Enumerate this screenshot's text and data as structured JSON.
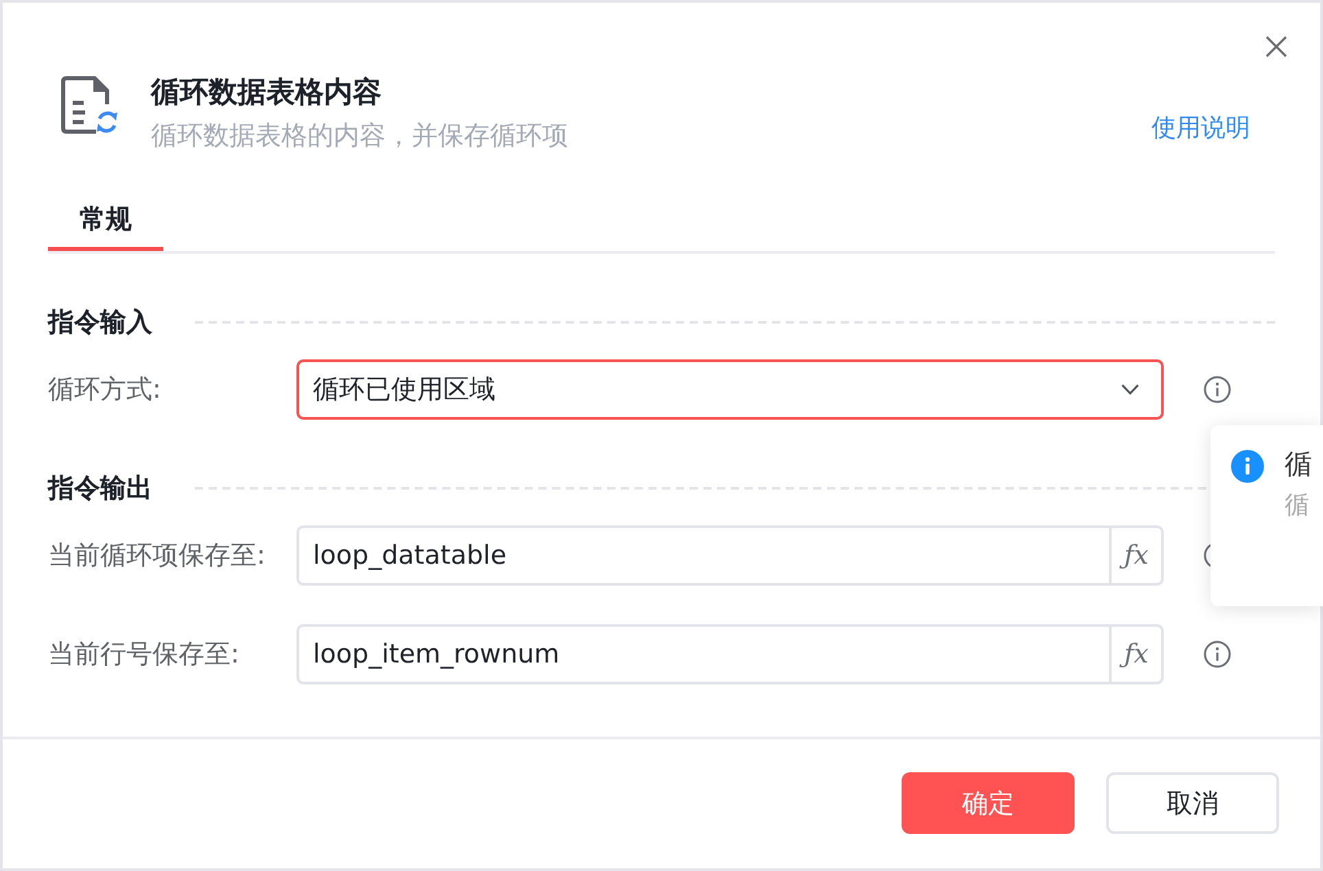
{
  "dialog": {
    "title": "循环数据表格内容",
    "subtitle": "循环数据表格的内容，并保存循环项",
    "help_link": "使用说明"
  },
  "tabs": [
    {
      "label": "常规",
      "selected": true
    }
  ],
  "sections": [
    {
      "title": "指令输入",
      "fields": [
        {
          "kind": "select",
          "label": "循环方式:",
          "value": "循环已使用区域",
          "focused": true
        }
      ]
    },
    {
      "title": "指令输出",
      "fields": [
        {
          "kind": "input",
          "label": "当前循环项保存至:",
          "value": "loop_datatable",
          "button": "ƒx",
          "focused": false
        },
        {
          "kind": "input",
          "label": "当前行号保存至:",
          "value": "loop_item_rownum",
          "button": "ƒx",
          "focused": false
        }
      ]
    }
  ],
  "popover": {
    "title": "循",
    "text": "循"
  },
  "buttons": [
    {
      "label": "确定",
      "kind": "primary"
    },
    {
      "label": "取消",
      "kind": "secondary"
    }
  ]
}
